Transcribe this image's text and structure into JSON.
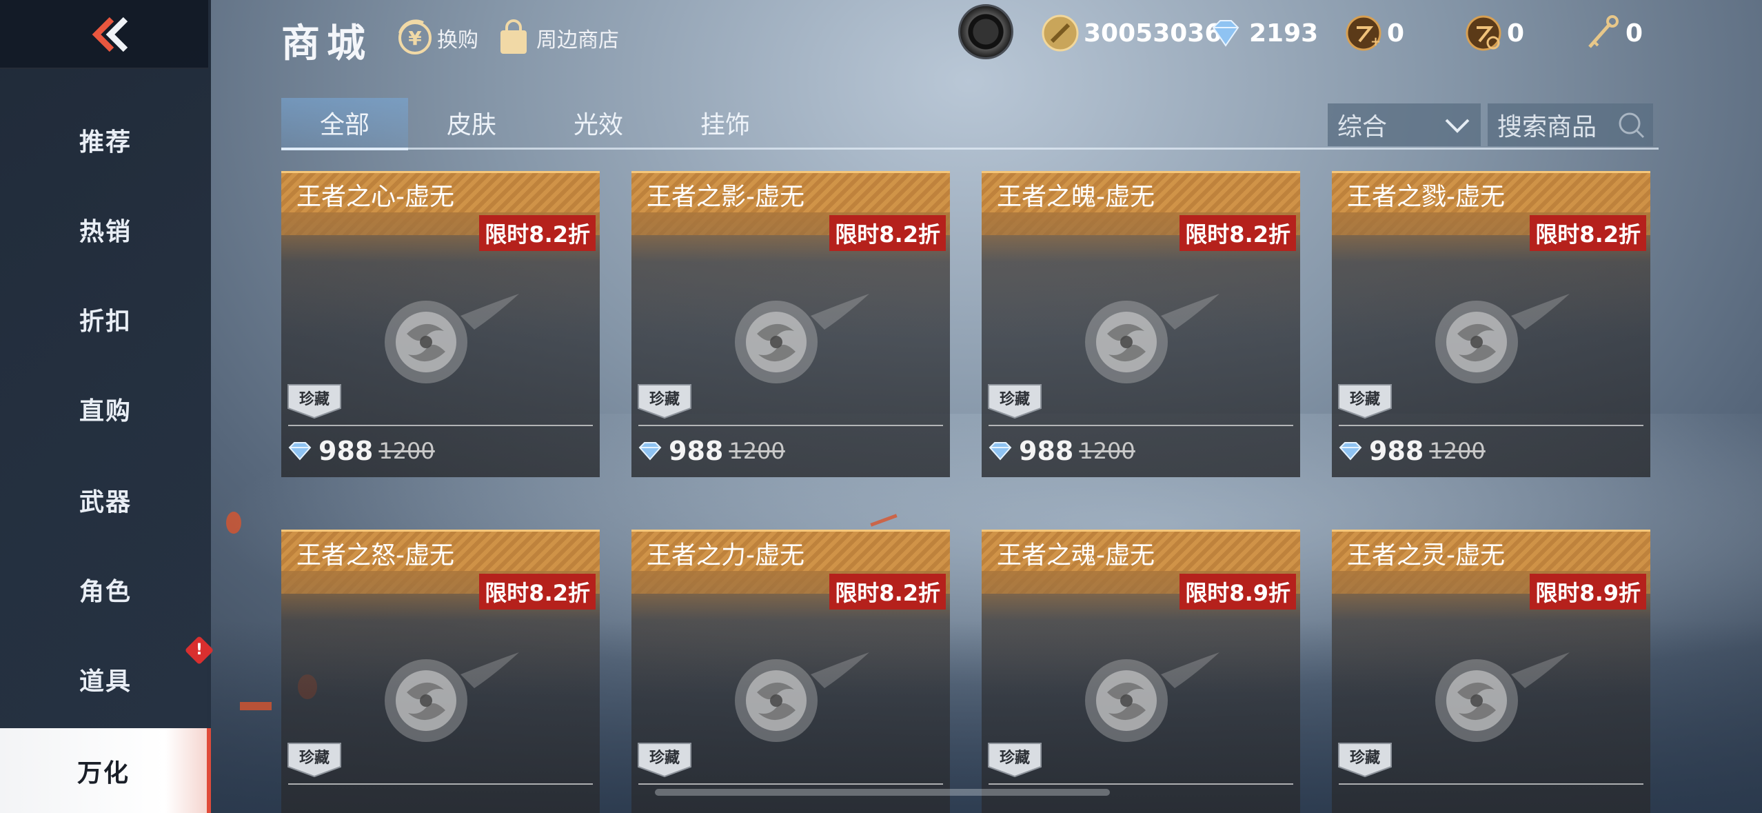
{
  "header": {
    "title": "商城",
    "exchange_label": "换购",
    "merch_label": "周边商店",
    "coins": "30053036",
    "diamonds": "2193",
    "voucher_a": "0",
    "voucher_b": "0",
    "keys": "0"
  },
  "sidebar": {
    "items": [
      {
        "label": "推荐"
      },
      {
        "label": "热销"
      },
      {
        "label": "折扣"
      },
      {
        "label": "直购"
      },
      {
        "label": "武器"
      },
      {
        "label": "角色"
      },
      {
        "label": "道具"
      },
      {
        "label": "万化"
      }
    ],
    "alert_text": "!"
  },
  "tabs": [
    {
      "label": "全部"
    },
    {
      "label": "皮肤"
    },
    {
      "label": "光效"
    },
    {
      "label": "挂饰"
    }
  ],
  "sort": {
    "label": "综合"
  },
  "search": {
    "placeholder": "搜索商品"
  },
  "products": [
    {
      "name": "王者之心-虚无",
      "discount": "限时8.2折",
      "tag": "珍藏",
      "price": "988",
      "original": "1200"
    },
    {
      "name": "王者之影-虚无",
      "discount": "限时8.2折",
      "tag": "珍藏",
      "price": "988",
      "original": "1200"
    },
    {
      "name": "王者之魄-虚无",
      "discount": "限时8.2折",
      "tag": "珍藏",
      "price": "988",
      "original": "1200"
    },
    {
      "name": "王者之戮-虚无",
      "discount": "限时8.2折",
      "tag": "珍藏",
      "price": "988",
      "original": "1200"
    },
    {
      "name": "王者之怒-虚无",
      "discount": "限时8.2折",
      "tag": "珍藏"
    },
    {
      "name": "王者之力-虚无",
      "discount": "限时8.2折",
      "tag": "珍藏"
    },
    {
      "name": "王者之魂-虚无",
      "discount": "限时8.9折",
      "tag": "珍藏"
    },
    {
      "name": "王者之灵-虚无",
      "discount": "限时8.9折",
      "tag": "珍藏"
    }
  ],
  "colors": {
    "accent": "#b5211c",
    "card_header": "#d6964a",
    "active_nav": "#e04b3a"
  }
}
